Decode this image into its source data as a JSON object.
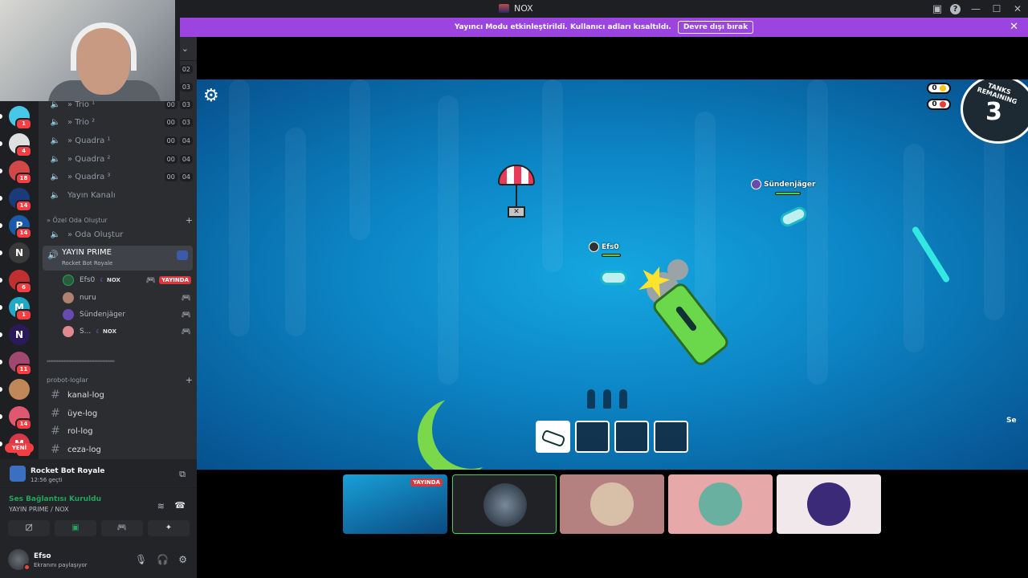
{
  "window": {
    "title": "NOX",
    "tools_icon": "▣",
    "minimize": "—",
    "maximize": "☐",
    "close": "✕",
    "help": "?"
  },
  "banner": {
    "message": "Yayıncı Modu etkinleştirildi. Kullanıcı adları kısaltıldı.",
    "button": "Devre dışı bırak",
    "close": "✕"
  },
  "rail": {
    "badges": [
      "1",
      "4",
      "18",
      "14",
      "14",
      "",
      "6",
      "1",
      "",
      "11",
      "",
      "14",
      "46"
    ],
    "letters": [
      "",
      "",
      "",
      "",
      "P",
      "N",
      "",
      "M",
      "N",
      "",
      "",
      "",
      "M"
    ],
    "new_label": "YENİ"
  },
  "channels": {
    "voice": [
      {
        "name": "» Trio ¹",
        "a": "00",
        "b": "03"
      },
      {
        "name": "» Trio ²",
        "a": "00",
        "b": "03"
      },
      {
        "name": "» Quadra ¹",
        "a": "00",
        "b": "04"
      },
      {
        "name": "» Quadra ²",
        "a": "00",
        "b": "04"
      },
      {
        "name": "» Quadra ³",
        "a": "00",
        "b": "04"
      }
    ],
    "top_counts": [
      "02",
      "03"
    ],
    "yayin_kanali": "Yayın Kanalı",
    "cat_ozel": "» Özel Oda Oluştur",
    "oda_olustur": "» Oda Oluştur",
    "active": {
      "name": "YAYIN PRIME",
      "sub": "Rocket Bot Royale"
    },
    "users": [
      {
        "name": "Efs0",
        "tag": "NOX",
        "live": "YAYINDA"
      },
      {
        "name": "nuru"
      },
      {
        "name": "Sündenjäger"
      },
      {
        "name": "S...",
        "tag": "NOX"
      }
    ],
    "separator": "══════════════════════════",
    "cat_probot": "probot-loglar",
    "text": [
      "kanal-log",
      "üye-log",
      "rol-log",
      "ceza-log"
    ]
  },
  "activity": {
    "title": "Rocket Bot Royale",
    "time": "12:56 geçti"
  },
  "voice": {
    "status": "Ses Bağlantısı Kuruldu",
    "channel": "YAYIN PRIME / NOX"
  },
  "user": {
    "name": "Efso",
    "status": "Ekranını paylaşıyor"
  },
  "game": {
    "tanks_label": "TANKS\nREMAINING",
    "tanks_value": "3",
    "counter1": "0",
    "counter2": "0",
    "player1": "Efs0",
    "player2": "Sündenjäger",
    "edge_tag": "Se",
    "gear": "⚙"
  },
  "tiles": {
    "live": "YAYINDA"
  },
  "colors": {
    "accent": "#9b44e0",
    "live": "#da373c",
    "online": "#23a55a",
    "badge": "#f23f43",
    "game_bg": "#0c84c4"
  }
}
